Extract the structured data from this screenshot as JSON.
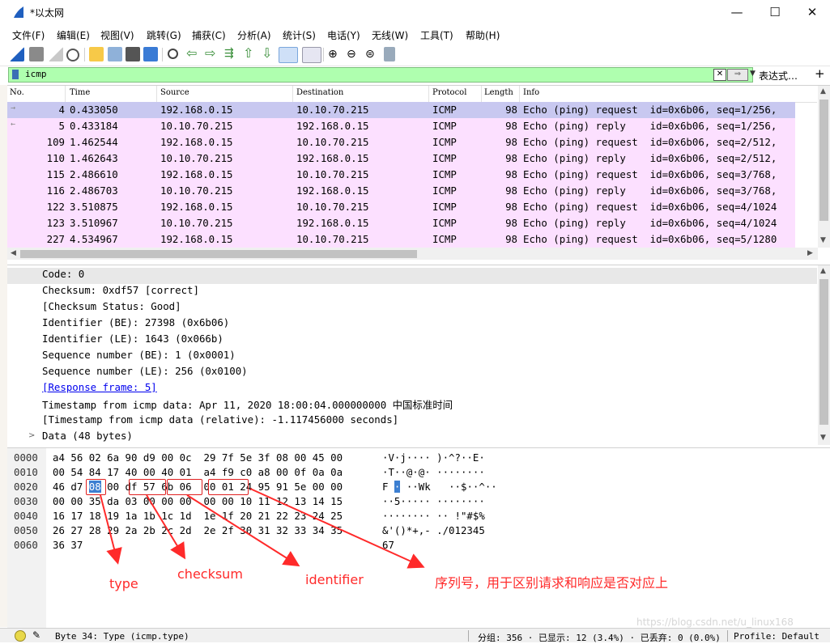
{
  "window": {
    "title": "*以太网",
    "minimize_icon": "minimize-icon",
    "maximize_icon": "maximize-icon",
    "close_icon": "close-icon"
  },
  "menu": [
    "文件(F)",
    "编辑(E)",
    "视图(V)",
    "跳转(G)",
    "捕获(C)",
    "分析(A)",
    "统计(S)",
    "电话(Y)",
    "无线(W)",
    "工具(T)",
    "帮助(H)"
  ],
  "filter": {
    "value": "icmp",
    "expression_label": "表达式…",
    "plus_label": "+"
  },
  "packet_list": {
    "columns": [
      "No.",
      "Time",
      "Source",
      "Destination",
      "Protocol",
      "Length",
      "Info"
    ],
    "rows": [
      {
        "no": "4",
        "time": "0.433050",
        "src": "192.168.0.15",
        "dst": "10.10.70.215",
        "proto": "ICMP",
        "len": "98",
        "info": "Echo (ping) request  id=0x6b06, seq=1/256,"
      },
      {
        "no": "5",
        "time": "0.433184",
        "src": "10.10.70.215",
        "dst": "192.168.0.15",
        "proto": "ICMP",
        "len": "98",
        "info": "Echo (ping) reply    id=0x6b06, seq=1/256,"
      },
      {
        "no": "109",
        "time": "1.462544",
        "src": "192.168.0.15",
        "dst": "10.10.70.215",
        "proto": "ICMP",
        "len": "98",
        "info": "Echo (ping) request  id=0x6b06, seq=2/512,"
      },
      {
        "no": "110",
        "time": "1.462643",
        "src": "10.10.70.215",
        "dst": "192.168.0.15",
        "proto": "ICMP",
        "len": "98",
        "info": "Echo (ping) reply    id=0x6b06, seq=2/512,"
      },
      {
        "no": "115",
        "time": "2.486610",
        "src": "192.168.0.15",
        "dst": "10.10.70.215",
        "proto": "ICMP",
        "len": "98",
        "info": "Echo (ping) request  id=0x6b06, seq=3/768,"
      },
      {
        "no": "116",
        "time": "2.486703",
        "src": "10.10.70.215",
        "dst": "192.168.0.15",
        "proto": "ICMP",
        "len": "98",
        "info": "Echo (ping) reply    id=0x6b06, seq=3/768,"
      },
      {
        "no": "122",
        "time": "3.510875",
        "src": "192.168.0.15",
        "dst": "10.10.70.215",
        "proto": "ICMP",
        "len": "98",
        "info": "Echo (ping) request  id=0x6b06, seq=4/1024"
      },
      {
        "no": "123",
        "time": "3.510967",
        "src": "10.10.70.215",
        "dst": "192.168.0.15",
        "proto": "ICMP",
        "len": "98",
        "info": "Echo (ping) reply    id=0x6b06, seq=4/1024"
      },
      {
        "no": "227",
        "time": "4.534967",
        "src": "192.168.0.15",
        "dst": "10.10.70.215",
        "proto": "ICMP",
        "len": "98",
        "info": "Echo (ping) request  id=0x6b06, seq=5/1280"
      }
    ]
  },
  "details": {
    "lines": [
      "Code: 0",
      "Checksum: 0xdf57 [correct]",
      "[Checksum Status: Good]",
      "Identifier (BE): 27398 (0x6b06)",
      "Identifier (LE): 1643 (0x066b)",
      "Sequence number (BE): 1 (0x0001)",
      "Sequence number (LE): 256 (0x0100)",
      "[Response frame: 5]",
      "Timestamp from icmp data: Apr 11, 2020 18:00:04.000000000 中国标准时间",
      "[Timestamp from icmp data (relative): -1.117456000 seconds]",
      "Data (48 bytes)"
    ]
  },
  "hex": {
    "offsets": [
      "0000",
      "0010",
      "0020",
      "0030",
      "0040",
      "0050",
      "0060"
    ],
    "bytes": [
      "a4 56 02 6a 90 d9 00 0c  29 7f 5e 3f 08 00 45 00",
      "00 54 84 17 40 00 40 01  a4 f9 c0 a8 00 0f 0a 0a",
      "46 d7 08 00 df 57 6b 06  00 01 24 95 91 5e 00 00",
      "00 00 35 da 03 00 00 00  00 00 10 11 12 13 14 15",
      "16 17 18 19 1a 1b 1c 1d  1e 1f 20 21 22 23 24 25",
      "26 27 28 29 2a 2b 2c 2d  2e 2f 30 31 32 33 34 35",
      "36 37"
    ],
    "ascii": [
      "·V·j···· )·^?··E·",
      "·T··@·@· ········",
      "F·······Wk ··$··^··",
      "··5····· ········",
      "········ ·· !\"#$%",
      "&'()*+,- ./012345",
      "67"
    ],
    "ascii_line3": {
      "pre": "F ",
      "hi": "·",
      "post": " ··Wk   ··$··^··"
    }
  },
  "annotations": {
    "type": "type",
    "checksum": "checksum",
    "identifier": "identifier",
    "sequence": "序列号，用于区别请求和响应是否对应上",
    "color": "#ff2a2a"
  },
  "status": {
    "byte_info": "Byte 34: Type (icmp.type)",
    "packets": "分组: 356 · 已显示: 12 (3.4%) · 已丢弃: 0 (0.0%)",
    "profile": "Profile: Default",
    "watermark": "https://blog.csdn.net/u_linux168"
  }
}
